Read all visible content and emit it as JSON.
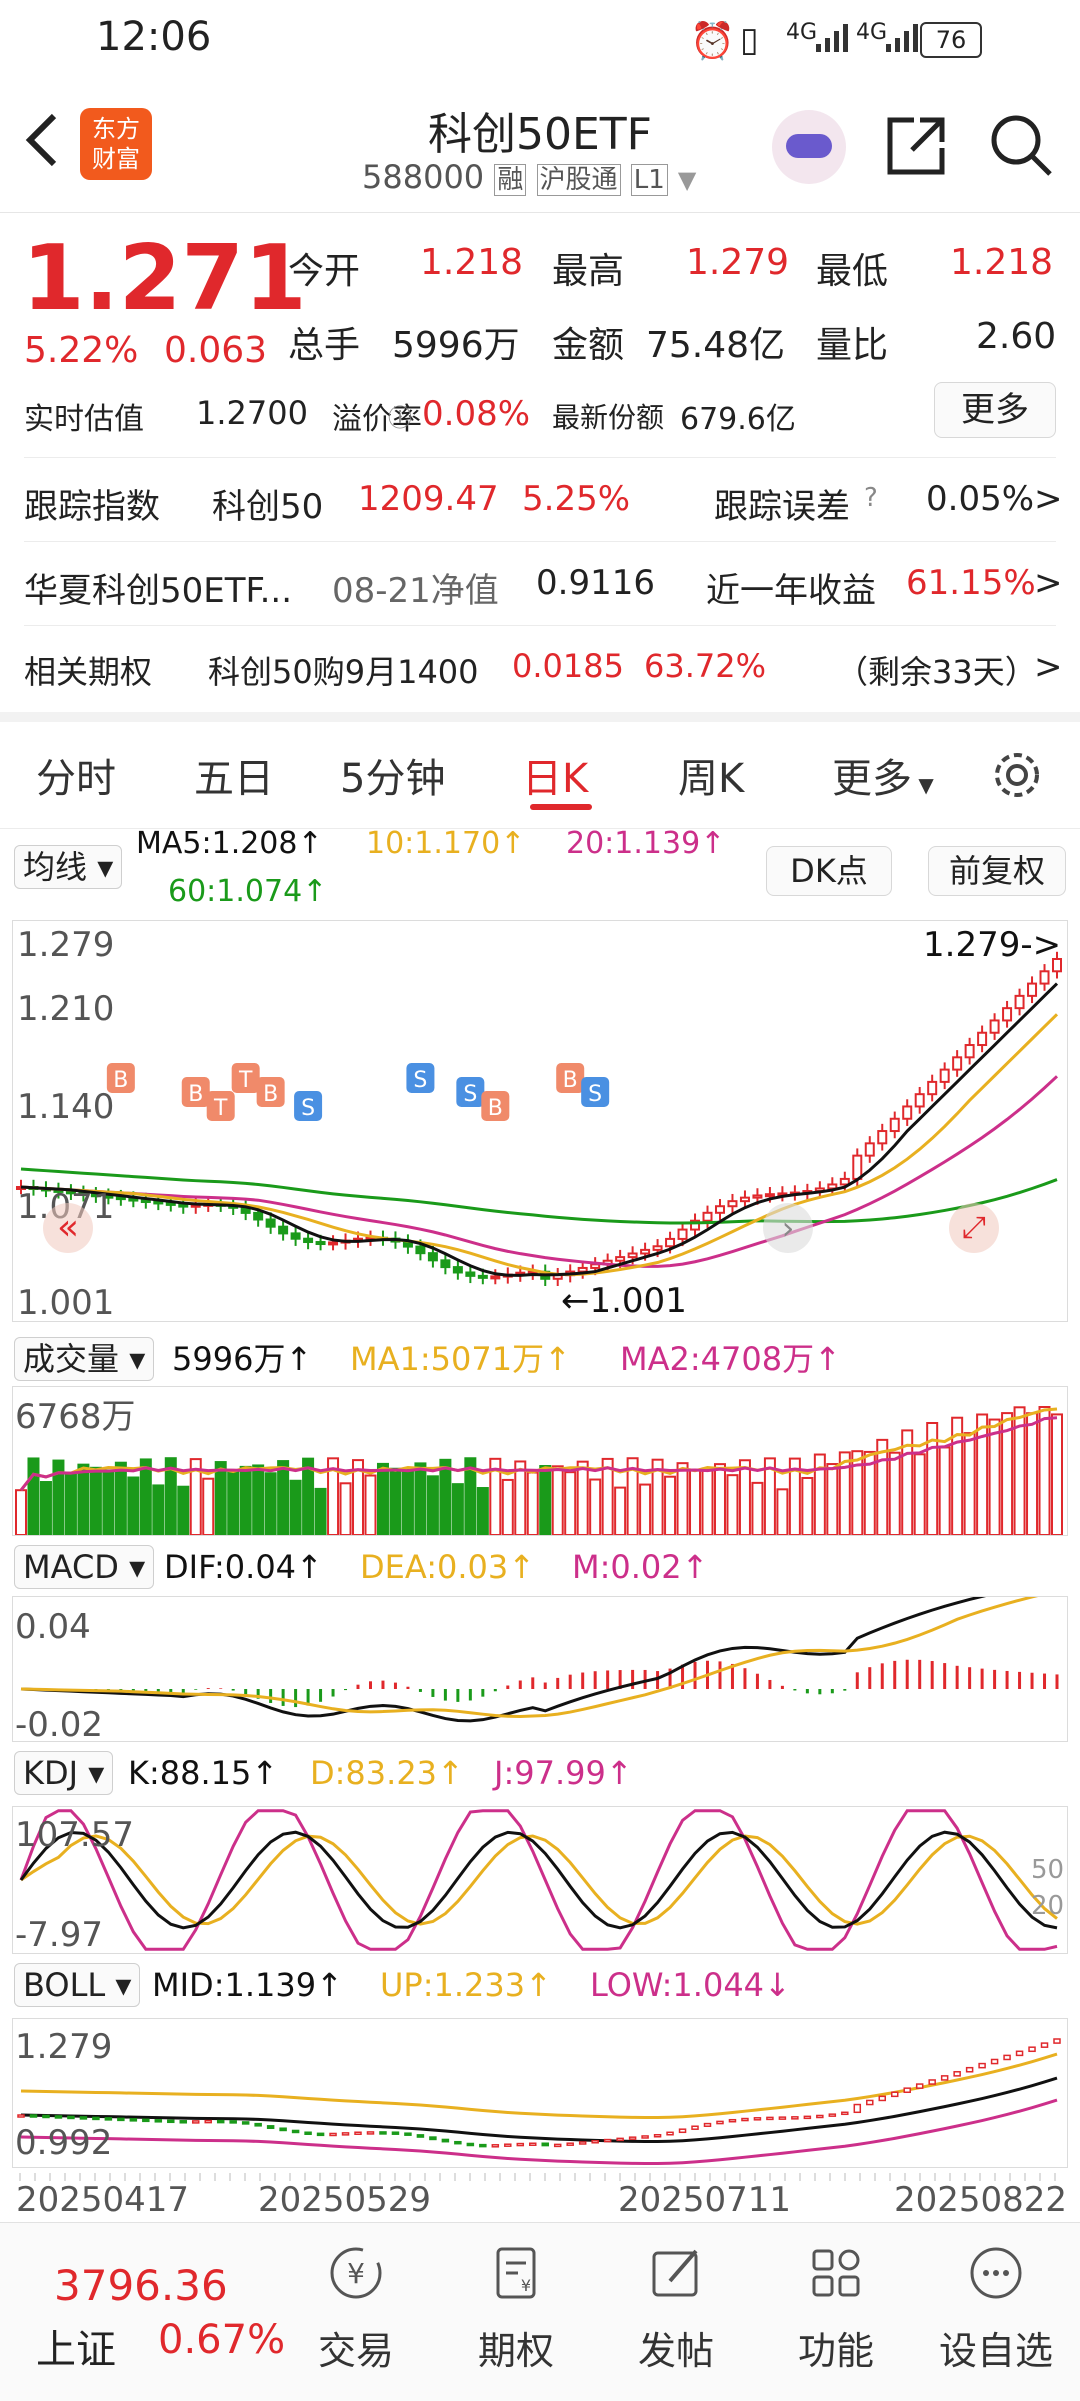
{
  "status_bar": {
    "time": "12:06",
    "battery": "76",
    "signal1": "4G",
    "signal2": "4G"
  },
  "header": {
    "logo_line1": "东方",
    "logo_line2": "财富",
    "title": "科创50ETF",
    "code": "588000",
    "tag_rong": "融",
    "tag_hgt": "沪股通",
    "tag_level": "L1"
  },
  "quote": {
    "price": "1.271",
    "change_pct": "5.22%",
    "change": "0.063",
    "stats": [
      {
        "label": "今开",
        "value": "1.218"
      },
      {
        "label": "最高",
        "value": "1.279"
      },
      {
        "label": "最低",
        "value": "1.218"
      },
      {
        "label": "总手",
        "value": "5996万"
      },
      {
        "label": "金额",
        "value": "75.48亿"
      },
      {
        "label": "量比",
        "value": "2.60"
      }
    ],
    "est_label": "实时估值",
    "est_value": "1.2700",
    "premium_label": "溢价率",
    "premium_value": "0.08%",
    "shares_label": "最新份额",
    "shares_value": "679.6亿",
    "more_label": "更多"
  },
  "info_rows": [
    {
      "c1": "跟踪指数",
      "c2": "科创50",
      "c3": "1209.47",
      "c4": "5.25%",
      "c5": "跟踪误差",
      "c6": "0.05%",
      "arrow": ">"
    },
    {
      "c1": "华夏科创50ETF...",
      "c2": "08-21净值",
      "c3": "0.9116",
      "c5": "近一年收益",
      "c6": "61.15%",
      "arrow": ">"
    },
    {
      "c1": "相关期权",
      "c2": "科创50购9月1400",
      "c3": "0.0185",
      "c4": "63.72%",
      "c5": "（剩余33天）",
      "arrow": ">"
    }
  ],
  "tabs": [
    "分时",
    "五日",
    "5分钟",
    "日K",
    "周K",
    "更多"
  ],
  "active_tab": "日K",
  "ma_header": {
    "selector": "均线",
    "ma5": "MA5:1.208↑",
    "ma10": "10:1.170↑",
    "ma20": "20:1.139↑",
    "ma60": "60:1.074↑",
    "dk_btn": "DK点",
    "fq_btn": "前复权"
  },
  "kline": {
    "y_top": "1.279",
    "y2": "1.210",
    "y3": "1.140",
    "y4": "1.071",
    "y_bot": "1.001",
    "max_mark": "1.279->",
    "min_mark": "←1.001",
    "markers": [
      "B",
      "B",
      "T",
      "T",
      "B",
      "S",
      "S",
      "S",
      "B",
      "B",
      "S"
    ]
  },
  "vol_header": {
    "selector": "成交量",
    "vol": "5996万↑",
    "ma1": "MA1:5071万↑",
    "ma2": "MA2:4708万↑",
    "y_top": "6768万"
  },
  "macd_header": {
    "selector": "MACD",
    "dif": "DIF:0.04↑",
    "dea": "DEA:0.03↑",
    "m": "M:0.02↑",
    "y_top": "0.04",
    "y_bot": "-0.02"
  },
  "kdj_header": {
    "selector": "KDJ",
    "k": "K:88.15↑",
    "d": "D:83.23↑",
    "j": "J:97.99↑",
    "y_top": "107.57",
    "y_bot": "-7.97",
    "l50": "50",
    "l20": "20"
  },
  "boll_header": {
    "selector": "BOLL",
    "mid": "MID:1.139↑",
    "up": "UP:1.233↑",
    "low": "LOW:1.044↓",
    "y_top": "1.279",
    "y_bot": "0.992"
  },
  "dates": [
    "20250417",
    "20250529",
    "20250711",
    "20250822"
  ],
  "bottom_bar": {
    "index_value": "3796.36",
    "index_name": "上证",
    "index_pct": "0.67%",
    "buttons": [
      "交易",
      "期权",
      "发帖",
      "功能",
      "设自选"
    ]
  },
  "colors": {
    "up": "#e0282c",
    "down": "#1a9a1a",
    "ma5": "#111111",
    "ma10": "#e8b020",
    "ma20": "#cc2f8a",
    "ma60": "#1a9a1a"
  }
}
